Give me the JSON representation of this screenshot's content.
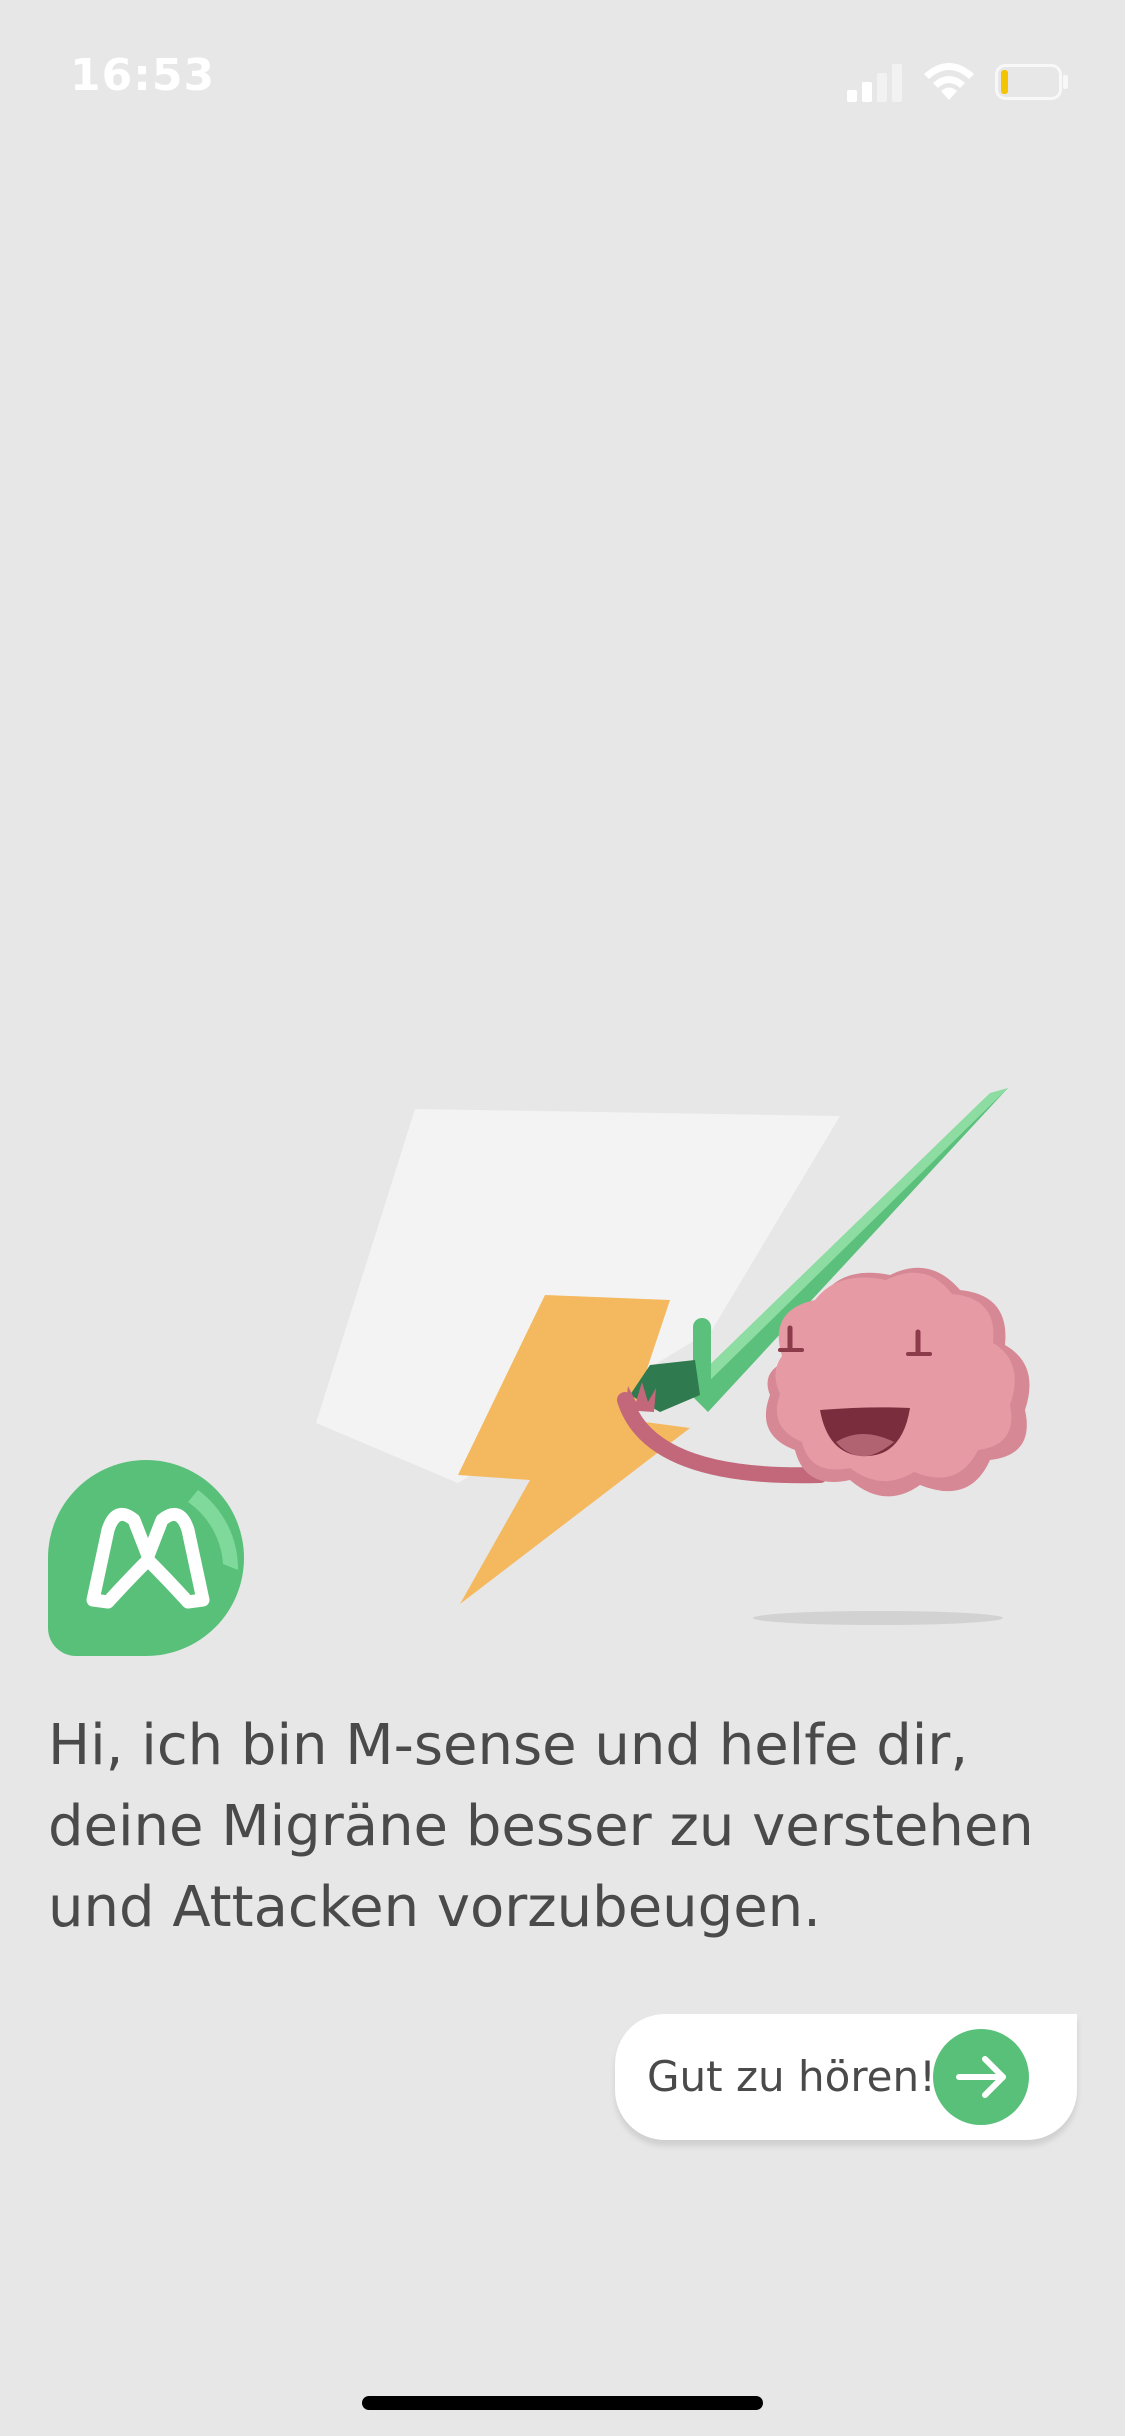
{
  "status_bar": {
    "time": "16:53",
    "icons": [
      "signal-icon",
      "wifi-icon",
      "battery-icon"
    ],
    "battery_level": 0.12,
    "battery_color": "#f5c400"
  },
  "logo": {
    "icon": "m-sense-logo",
    "color": "#59c07a"
  },
  "illustration": {
    "elements": [
      "lightning-bolt",
      "brain-character",
      "green-sword",
      "white-paper"
    ]
  },
  "message": {
    "lines": [
      "Hi, ich bin M-sense und helfe dir,",
      "deine Migräne besser zu verstehen",
      "und Attacken vorzubeugen."
    ]
  },
  "reply": {
    "label": "Gut zu hören!",
    "icon": "arrow-right-icon",
    "accent": "#59c07a"
  }
}
